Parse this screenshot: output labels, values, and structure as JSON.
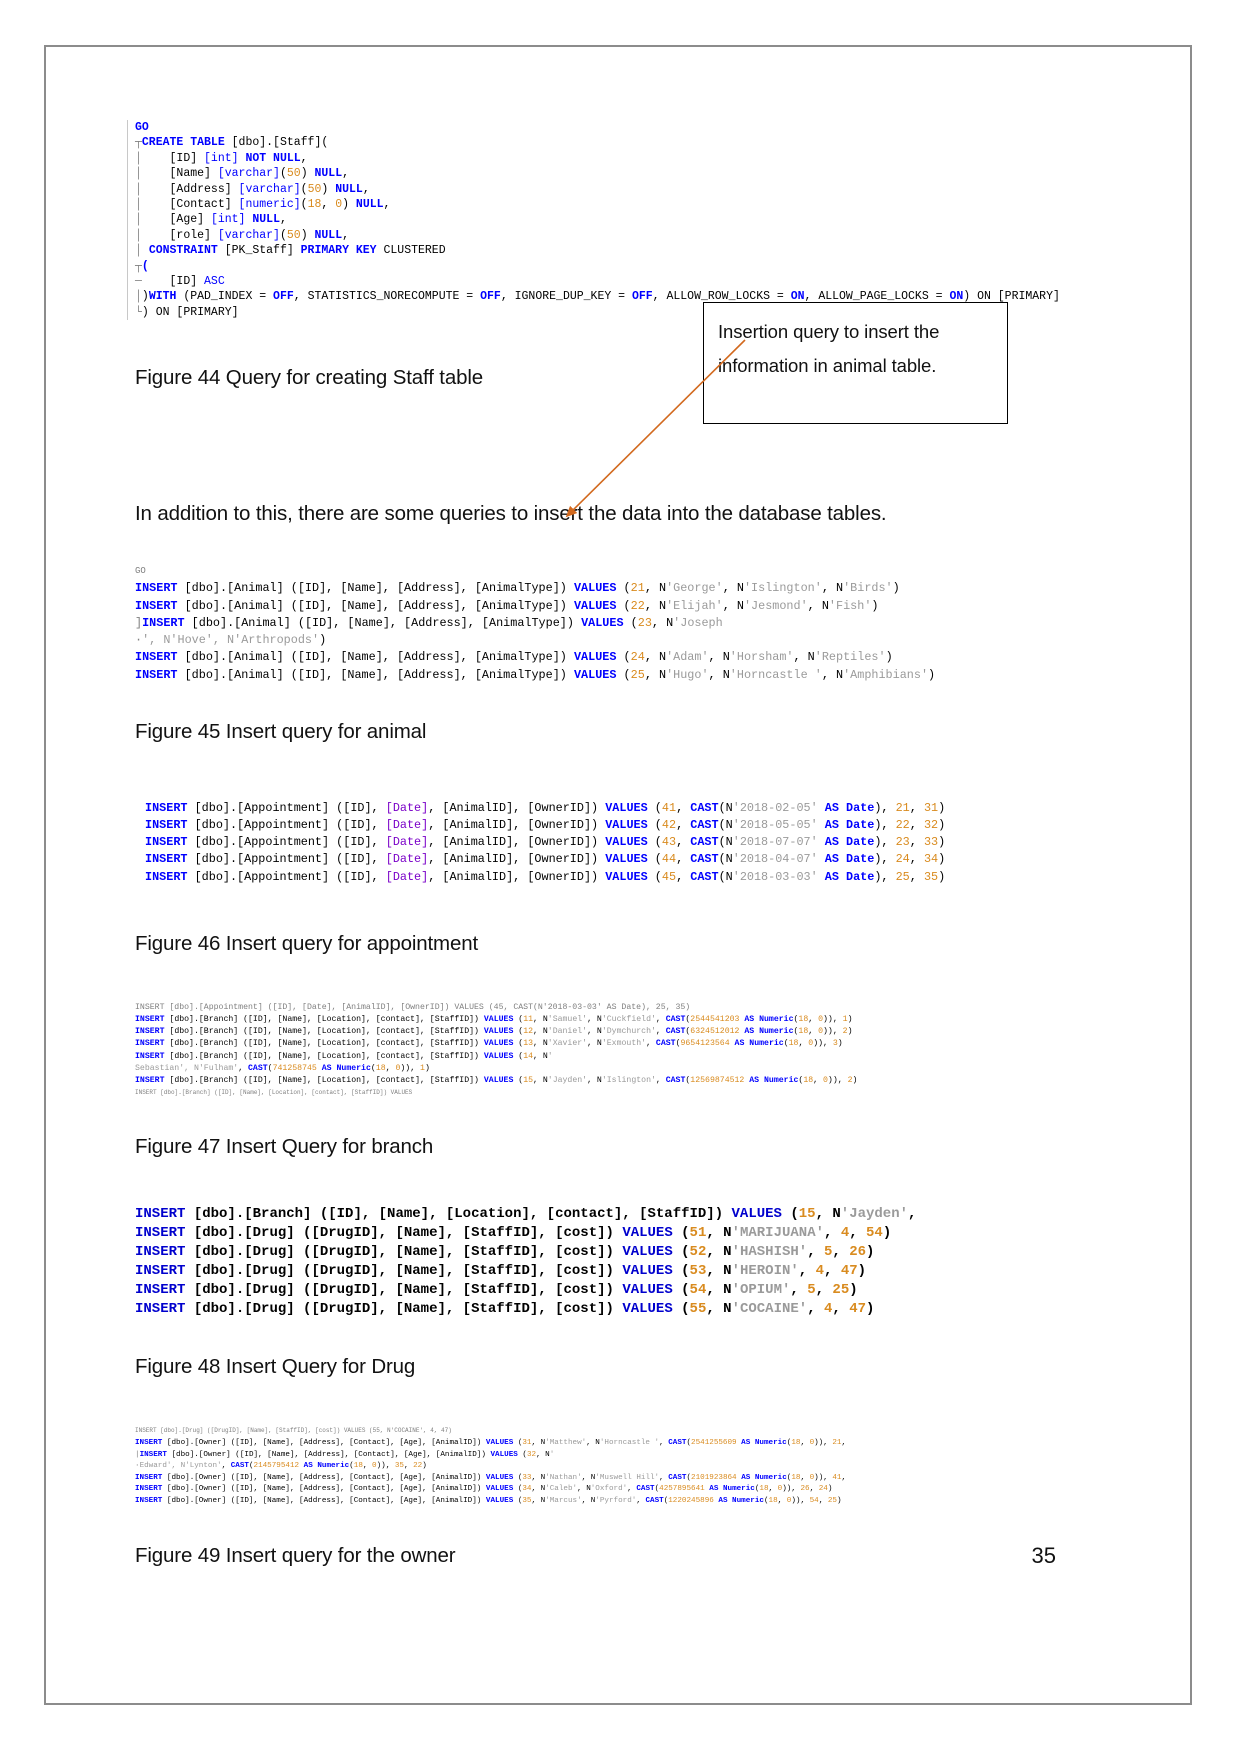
{
  "page": {
    "number": "35"
  },
  "callout": {
    "line1": "Insertion query to insert the",
    "line2": "information in animal table."
  },
  "body": {
    "paragraph1": "In addition to this, there are some queries to insert the data into the database tables."
  },
  "captions": {
    "fig44": "Figure 44 Query for creating Staff table",
    "fig45": "Figure 45 Insert query for animal",
    "fig46": "Figure 46 Insert query for appointment",
    "fig47": "Figure 47 Insert Query for branch",
    "fig48": "Figure 48 Insert Query for Drug",
    "fig49": "Figure 49 Insert query for the owner"
  },
  "code": {
    "staff_table": "GO\nCREATE TABLE [dbo].[Staff](\n    [ID] [int] NOT NULL,\n    [Name] [varchar](50) NULL,\n    [Address] [varchar](50) NULL,\n    [Contact] [numeric](18, 0) NULL,\n    [Age] [int] NULL,\n    [role] [varchar](50) NULL,\n CONSTRAINT [PK_Staff] PRIMARY KEY CLUSTERED\n(\n    [ID] ASC\n)WITH (PAD_INDEX = OFF, STATISTICS_NORECOMPUTE = OFF, IGNORE_DUP_KEY = OFF, ALLOW_ROW_LOCKS = ON, ALLOW_PAGE_LOCKS = ON) ON [PRIMARY]\n) ON [PRIMARY]",
    "animal_insert": [
      "GO",
      "INSERT [dbo].[Animal] ([ID], [Name], [Address], [AnimalType]) VALUES (21, N'George', N'Islington', N'Birds')",
      "INSERT [dbo].[Animal] ([ID], [Name], [Address], [AnimalType]) VALUES (22, N'Elijah', N'Jesmond', N'Fish')",
      "INSERT [dbo].[Animal] ([ID], [Name], [Address], [AnimalType]) VALUES (23, N'Joseph",
      "', N'Hove', N'Arthropods')",
      "INSERT [dbo].[Animal] ([ID], [Name], [Address], [AnimalType]) VALUES (24, N'Adam', N'Horsham', N'Reptiles')",
      "INSERT [dbo].[Animal] ([ID], [Name], [Address], [AnimalType]) VALUES (25, N'Hugo', N'Horncastle ', N'Amphibians')"
    ],
    "appointment_insert": [
      "INSERT [dbo].[Appointment] ([ID], [Date], [AnimalID], [OwnerID]) VALUES (41, CAST(N'2018-02-05' AS Date), 21, 31)",
      "INSERT [dbo].[Appointment] ([ID], [Date], [AnimalID], [OwnerID]) VALUES (42, CAST(N'2018-05-05' AS Date), 22, 32)",
      "INSERT [dbo].[Appointment] ([ID], [Date], [AnimalID], [OwnerID]) VALUES (43, CAST(N'2018-07-07' AS Date), 23, 33)",
      "INSERT [dbo].[Appointment] ([ID], [Date], [AnimalID], [OwnerID]) VALUES (44, CAST(N'2018-04-07' AS Date), 24, 34)",
      "INSERT [dbo].[Appointment] ([ID], [Date], [AnimalID], [OwnerID]) VALUES (45, CAST(N'2018-03-03' AS Date), 25, 35)"
    ],
    "branch_insert": [
      "INSERT [dbo].[Appointment] ([ID], [Date], [AnimalID], [OwnerID]) VALUES (45, CAST(N'2018-03-03' AS Date), 25, 35)",
      "INSERT [dbo].[Branch] ([ID], [Name], [Location], [contact], [StaffID]) VALUES (11, N'Samuel', N'Cuckfield', CAST(2544541203 AS Numeric(18, 0)), 1)",
      "INSERT [dbo].[Branch] ([ID], [Name], [Location], [contact], [StaffID]) VALUES (12, N'Daniel', N'Dymchurch', CAST(6324512012 AS Numeric(18, 0)), 2)",
      "INSERT [dbo].[Branch] ([ID], [Name], [Location], [contact], [StaffID]) VALUES (13, N'Xavier', N'Exmouth', CAST(9654123564 AS Numeric(18, 0)), 3)",
      "INSERT [dbo].[Branch] ([ID], [Name], [Location], [contact], [StaffID]) VALUES (14, N'",
      "Sebastian', N'Fulham', CAST(741258745 AS Numeric(18, 0)), 1)",
      "INSERT [dbo].[Branch] ([ID], [Name], [Location], [contact], [StaffID]) VALUES (15, N'Jayden', N'Islington', CAST(12569874512 AS Numeric(18, 0)), 2)"
    ],
    "drug_insert": [
      "INSERT [dbo].[Branch] ([ID], [Name], [Location], [contact], [StaffID]) VALUES (15, N'Jayden',",
      "INSERT [dbo].[Drug] ([DrugID], [Name], [StaffID], [cost]) VALUES (51, N'MARIJUANA', 4, 54)",
      "INSERT [dbo].[Drug] ([DrugID], [Name], [StaffID], [cost]) VALUES (52, N'HASHISH', 5, 26)",
      "INSERT [dbo].[Drug] ([DrugID], [Name], [StaffID], [cost]) VALUES (53, N'HEROIN', 4, 47)",
      "INSERT [dbo].[Drug] ([DrugID], [Name], [StaffID], [cost]) VALUES (54, N'OPIUM', 5, 25)",
      "INSERT [dbo].[Drug] ([DrugID], [Name], [StaffID], [cost]) VALUES (55, N'COCAINE', 4, 47)"
    ],
    "owner_insert": [
      "INSERT [dbo].[Drug] ([DrugID], [Name], [StaffID], [cost]) VALUES (55, N'COCAINE', 4, 47)",
      "INSERT [dbo].[Owner] ([ID], [Name], [Address], [Contact], [Age], [AnimalID]) VALUES (31, N'Matthew', N'Horncastle ', CAST(2541255609 AS Numeric(18, 0)), 21,",
      "INSERT [dbo].[Owner] ([ID], [Name], [Address], [Contact], [Age], [AnimalID]) VALUES (32, N'",
      "Edward', N'Lynton', CAST(2145795412 AS Numeric(18, 0)), 35, 22)",
      "INSERT [dbo].[Owner] ([ID], [Name], [Address], [Contact], [Age], [AnimalID]) VALUES (33, N'Nathan', N'Muswell Hill', CAST(2101923864 AS Numeric(18, 0)), 41,",
      "INSERT [dbo].[Owner] ([ID], [Name], [Address], [Contact], [Age], [AnimalID]) VALUES (34, N'Caleb', N'Oxford', CAST(4257895641 AS Numeric(18, 0)), 26, 24)",
      "INSERT [dbo].[Owner] ([ID], [Name], [Address], [Contact], [Age], [AnimalID]) VALUES (35, N'Marcus', N'Pyrford', CAST(1220245896 AS Numeric(18, 0)), 54, 25)"
    ]
  },
  "colors": {
    "keyword": "#0000ff",
    "number": "#d98b1f",
    "string": "#9a9a9a",
    "arrow": "#d2691e",
    "border": "#8c8c8c"
  }
}
